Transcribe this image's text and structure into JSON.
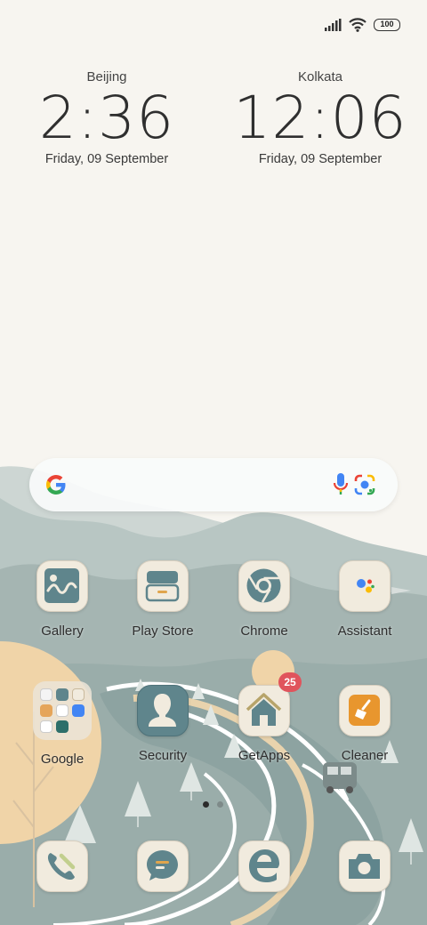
{
  "status_bar": {
    "icons": [
      "signal-icon",
      "wifi-icon",
      "battery-icon"
    ],
    "battery_level": "100"
  },
  "clocks": [
    {
      "city": "Beijing",
      "time": "2:36",
      "date": "Friday, 09 September"
    },
    {
      "city": "Kolkata",
      "time": "12:06",
      "date": "Friday, 09 September"
    }
  ],
  "search_bar": {
    "icons": [
      "google-logo-icon",
      "microphone-icon",
      "google-lens-icon"
    ]
  },
  "apps_row1": [
    {
      "label": "Gallery",
      "icon": "gallery-icon"
    },
    {
      "label": "Play Store",
      "icon": "play-store-icon"
    },
    {
      "label": "Chrome",
      "icon": "chrome-icon"
    },
    {
      "label": "Assistant",
      "icon": "assistant-icon"
    }
  ],
  "apps_row2": [
    {
      "label": "Google",
      "icon": "google-folder-icon"
    },
    {
      "label": "Security",
      "icon": "security-icon"
    },
    {
      "label": "GetApps",
      "icon": "getapps-icon",
      "badge": "25"
    },
    {
      "label": "Cleaner",
      "icon": "cleaner-icon"
    }
  ],
  "page_indicator": {
    "pages": 2,
    "current": 1
  },
  "dock": [
    {
      "icon": "phone-icon"
    },
    {
      "icon": "messages-icon"
    },
    {
      "icon": "browser-icon"
    },
    {
      "icon": "camera-icon"
    }
  ],
  "colors": {
    "background": "#f7f5f0",
    "icon_tile": "#f1ebde",
    "icon_teal": "#5f858c",
    "badge": "#e0545c",
    "cleaner_orange": "#e8962e",
    "sun": "#f0d4a8"
  }
}
